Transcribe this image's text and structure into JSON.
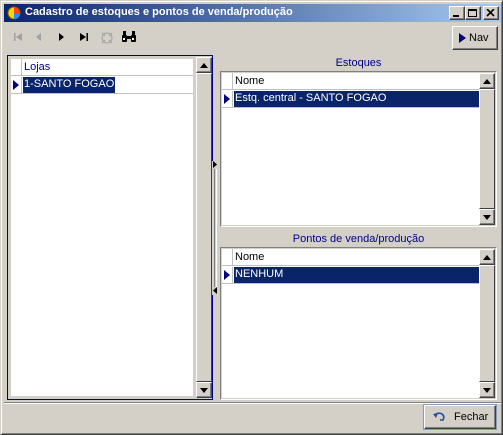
{
  "window": {
    "title": "Cadastro de estoques e pontos de venda/produção",
    "app_icon": "app-orb-icon",
    "controls": [
      "minimize-icon",
      "maximize-icon",
      "close-icon"
    ]
  },
  "toolbar": {
    "items": [
      {
        "name": "first-record-icon",
        "enabled": false
      },
      {
        "name": "prior-record-icon",
        "enabled": false
      },
      {
        "name": "next-record-icon",
        "enabled": true
      },
      {
        "name": "last-record-icon",
        "enabled": true
      },
      {
        "name": "refresh-icon",
        "enabled": false
      },
      {
        "name": "search-binoculars-icon",
        "enabled": true
      }
    ],
    "nav_label": "Nav"
  },
  "lojas": {
    "header": "Lojas",
    "rows": [
      "1-SANTO FOGAO"
    ]
  },
  "estoques": {
    "caption": "Estoques",
    "header": "Nome",
    "rows": [
      "Estq. central - SANTO FOGAO"
    ]
  },
  "pontos": {
    "caption": "Pontos de venda/produção",
    "header": "Nome",
    "rows": [
      "NENHUM"
    ]
  },
  "footer": {
    "close_label": "Fechar",
    "close_icon": "close-return-icon"
  },
  "colors": {
    "selection": "#0a246a",
    "header_text": "#000080",
    "title_gradient_start": "#0a246a",
    "title_gradient_end": "#a6caf0",
    "face": "#d4d0c8"
  }
}
